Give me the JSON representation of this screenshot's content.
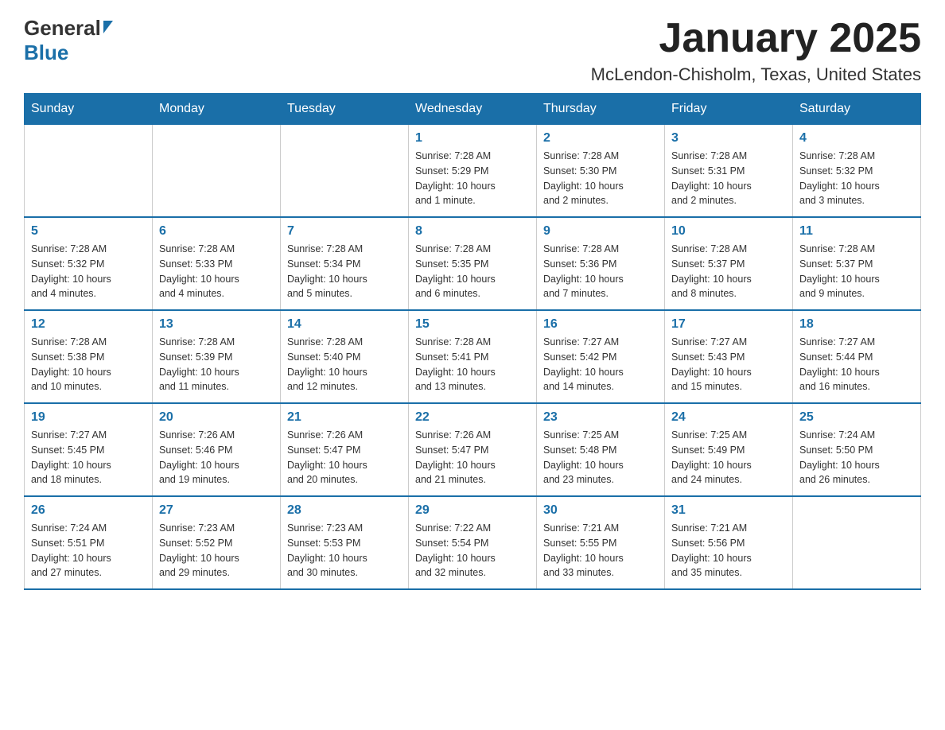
{
  "header": {
    "logo_general": "General",
    "logo_blue": "Blue",
    "title": "January 2025",
    "subtitle": "McLendon-Chisholm, Texas, United States"
  },
  "days_of_week": [
    "Sunday",
    "Monday",
    "Tuesday",
    "Wednesday",
    "Thursday",
    "Friday",
    "Saturday"
  ],
  "weeks": [
    {
      "days": [
        {
          "number": "",
          "info": ""
        },
        {
          "number": "",
          "info": ""
        },
        {
          "number": "",
          "info": ""
        },
        {
          "number": "1",
          "info": "Sunrise: 7:28 AM\nSunset: 5:29 PM\nDaylight: 10 hours\nand 1 minute."
        },
        {
          "number": "2",
          "info": "Sunrise: 7:28 AM\nSunset: 5:30 PM\nDaylight: 10 hours\nand 2 minutes."
        },
        {
          "number": "3",
          "info": "Sunrise: 7:28 AM\nSunset: 5:31 PM\nDaylight: 10 hours\nand 2 minutes."
        },
        {
          "number": "4",
          "info": "Sunrise: 7:28 AM\nSunset: 5:32 PM\nDaylight: 10 hours\nand 3 minutes."
        }
      ]
    },
    {
      "days": [
        {
          "number": "5",
          "info": "Sunrise: 7:28 AM\nSunset: 5:32 PM\nDaylight: 10 hours\nand 4 minutes."
        },
        {
          "number": "6",
          "info": "Sunrise: 7:28 AM\nSunset: 5:33 PM\nDaylight: 10 hours\nand 4 minutes."
        },
        {
          "number": "7",
          "info": "Sunrise: 7:28 AM\nSunset: 5:34 PM\nDaylight: 10 hours\nand 5 minutes."
        },
        {
          "number": "8",
          "info": "Sunrise: 7:28 AM\nSunset: 5:35 PM\nDaylight: 10 hours\nand 6 minutes."
        },
        {
          "number": "9",
          "info": "Sunrise: 7:28 AM\nSunset: 5:36 PM\nDaylight: 10 hours\nand 7 minutes."
        },
        {
          "number": "10",
          "info": "Sunrise: 7:28 AM\nSunset: 5:37 PM\nDaylight: 10 hours\nand 8 minutes."
        },
        {
          "number": "11",
          "info": "Sunrise: 7:28 AM\nSunset: 5:37 PM\nDaylight: 10 hours\nand 9 minutes."
        }
      ]
    },
    {
      "days": [
        {
          "number": "12",
          "info": "Sunrise: 7:28 AM\nSunset: 5:38 PM\nDaylight: 10 hours\nand 10 minutes."
        },
        {
          "number": "13",
          "info": "Sunrise: 7:28 AM\nSunset: 5:39 PM\nDaylight: 10 hours\nand 11 minutes."
        },
        {
          "number": "14",
          "info": "Sunrise: 7:28 AM\nSunset: 5:40 PM\nDaylight: 10 hours\nand 12 minutes."
        },
        {
          "number": "15",
          "info": "Sunrise: 7:28 AM\nSunset: 5:41 PM\nDaylight: 10 hours\nand 13 minutes."
        },
        {
          "number": "16",
          "info": "Sunrise: 7:27 AM\nSunset: 5:42 PM\nDaylight: 10 hours\nand 14 minutes."
        },
        {
          "number": "17",
          "info": "Sunrise: 7:27 AM\nSunset: 5:43 PM\nDaylight: 10 hours\nand 15 minutes."
        },
        {
          "number": "18",
          "info": "Sunrise: 7:27 AM\nSunset: 5:44 PM\nDaylight: 10 hours\nand 16 minutes."
        }
      ]
    },
    {
      "days": [
        {
          "number": "19",
          "info": "Sunrise: 7:27 AM\nSunset: 5:45 PM\nDaylight: 10 hours\nand 18 minutes."
        },
        {
          "number": "20",
          "info": "Sunrise: 7:26 AM\nSunset: 5:46 PM\nDaylight: 10 hours\nand 19 minutes."
        },
        {
          "number": "21",
          "info": "Sunrise: 7:26 AM\nSunset: 5:47 PM\nDaylight: 10 hours\nand 20 minutes."
        },
        {
          "number": "22",
          "info": "Sunrise: 7:26 AM\nSunset: 5:47 PM\nDaylight: 10 hours\nand 21 minutes."
        },
        {
          "number": "23",
          "info": "Sunrise: 7:25 AM\nSunset: 5:48 PM\nDaylight: 10 hours\nand 23 minutes."
        },
        {
          "number": "24",
          "info": "Sunrise: 7:25 AM\nSunset: 5:49 PM\nDaylight: 10 hours\nand 24 minutes."
        },
        {
          "number": "25",
          "info": "Sunrise: 7:24 AM\nSunset: 5:50 PM\nDaylight: 10 hours\nand 26 minutes."
        }
      ]
    },
    {
      "days": [
        {
          "number": "26",
          "info": "Sunrise: 7:24 AM\nSunset: 5:51 PM\nDaylight: 10 hours\nand 27 minutes."
        },
        {
          "number": "27",
          "info": "Sunrise: 7:23 AM\nSunset: 5:52 PM\nDaylight: 10 hours\nand 29 minutes."
        },
        {
          "number": "28",
          "info": "Sunrise: 7:23 AM\nSunset: 5:53 PM\nDaylight: 10 hours\nand 30 minutes."
        },
        {
          "number": "29",
          "info": "Sunrise: 7:22 AM\nSunset: 5:54 PM\nDaylight: 10 hours\nand 32 minutes."
        },
        {
          "number": "30",
          "info": "Sunrise: 7:21 AM\nSunset: 5:55 PM\nDaylight: 10 hours\nand 33 minutes."
        },
        {
          "number": "31",
          "info": "Sunrise: 7:21 AM\nSunset: 5:56 PM\nDaylight: 10 hours\nand 35 minutes."
        },
        {
          "number": "",
          "info": ""
        }
      ]
    }
  ]
}
